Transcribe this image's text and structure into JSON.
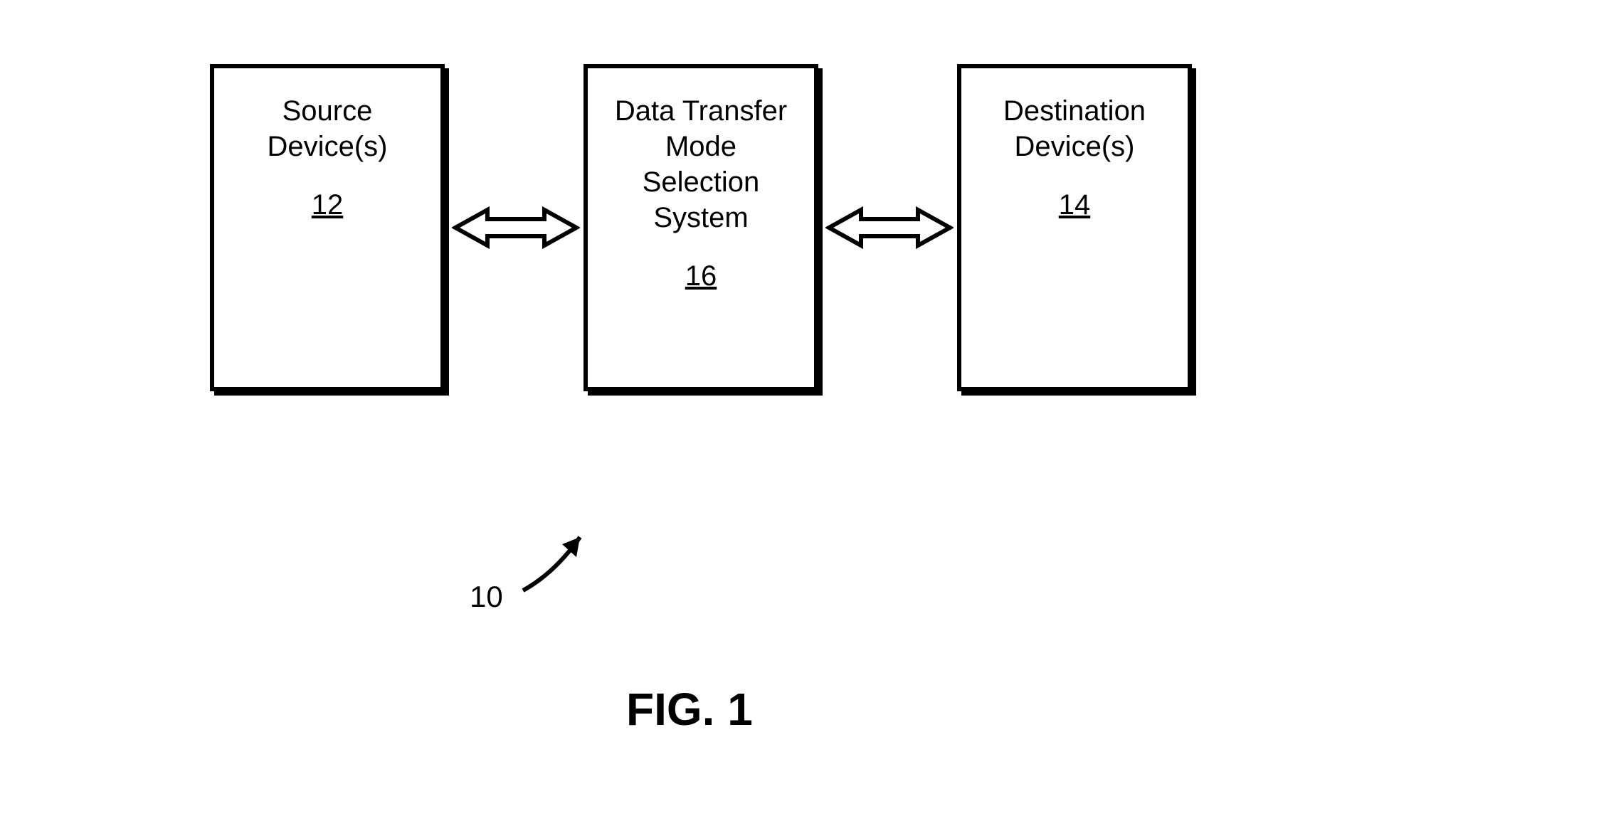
{
  "boxes": {
    "source": {
      "title": "Source\nDevice(s)",
      "ref": "12"
    },
    "system": {
      "title": "Data Transfer\nMode\nSelection\nSystem",
      "ref": "16"
    },
    "destination": {
      "title": "Destination\nDevice(s)",
      "ref": "14"
    }
  },
  "overall_ref": "10",
  "figure_label": "FIG. 1"
}
